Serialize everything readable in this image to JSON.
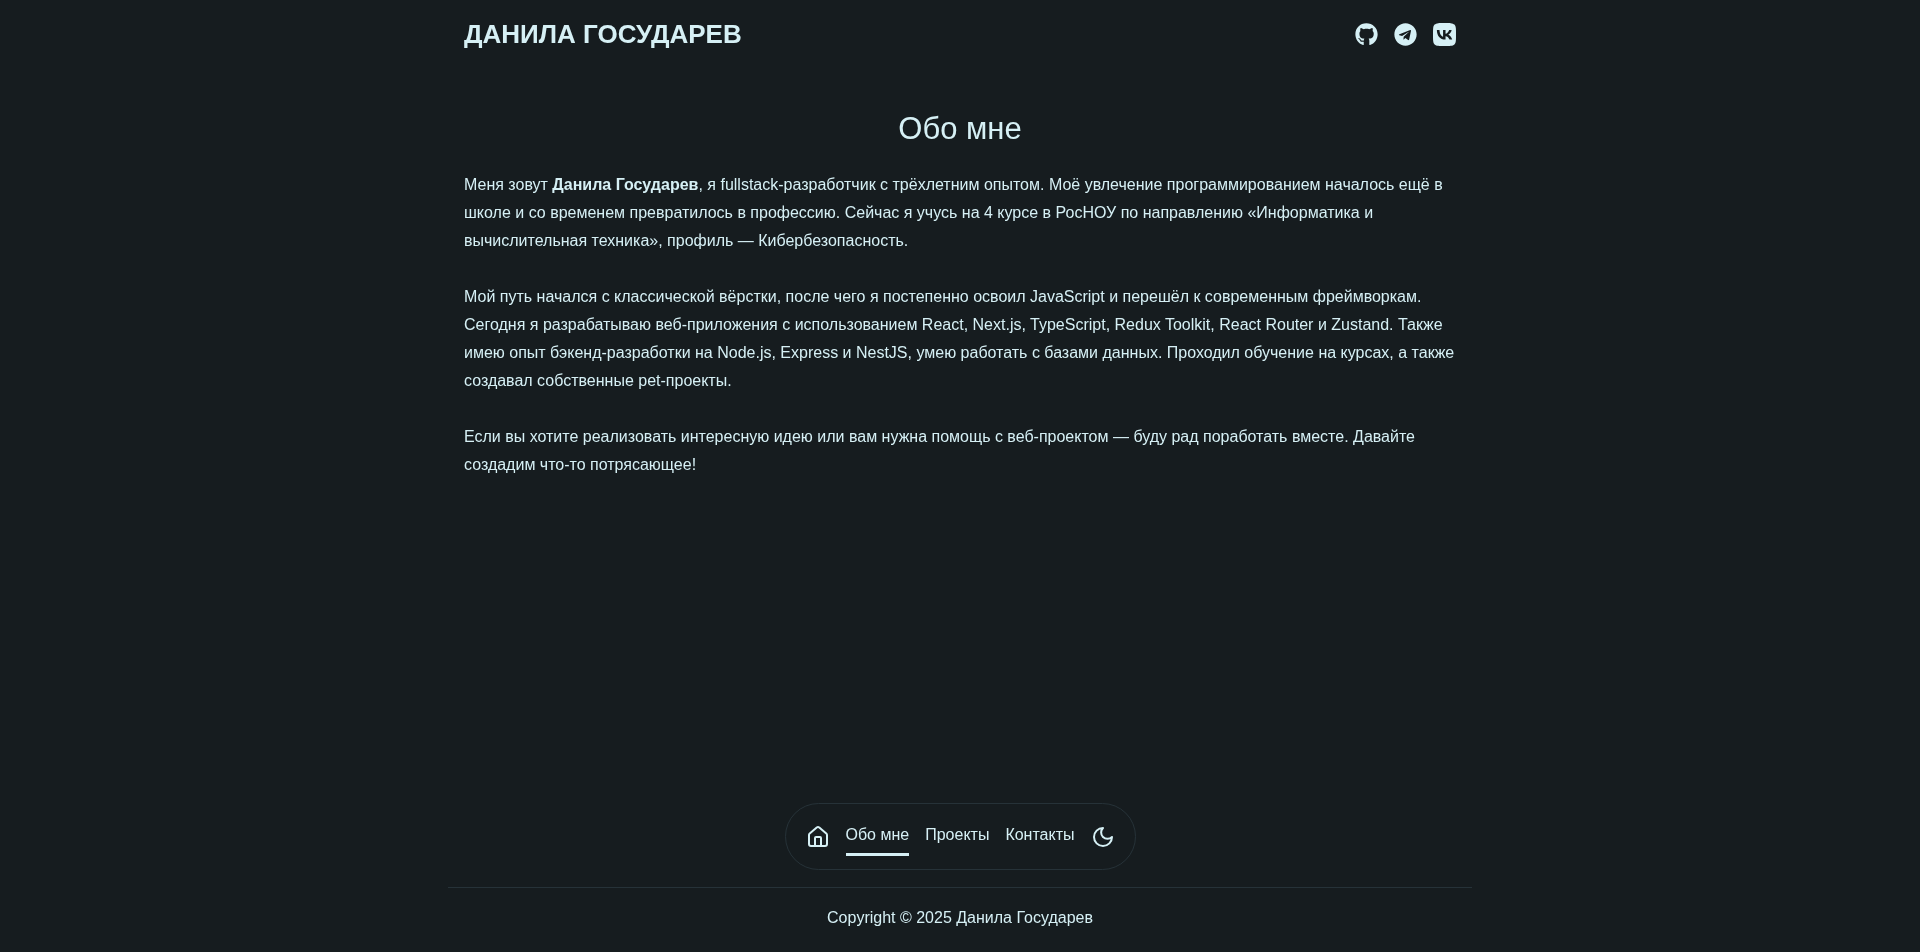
{
  "header": {
    "title": "ДАНИЛА ГОСУДАРЕВ",
    "social_links": [
      {
        "kind": "github"
      },
      {
        "kind": "telegram"
      },
      {
        "kind": "vk"
      }
    ]
  },
  "about": {
    "heading": "Обо мне",
    "paragraphs": [
      "Меня зовут **Данила Государев**, я fullstack-разработчик с трёхлетним опытом. Моё увлечение программированием началось ещё в школе и со временем превратилось в профессию. Сейчас я учусь на 4 курсе в РосНОУ по направлению «Информатика и вычислительная техника», профиль — Кибербезопасность.",
      "Мой путь начался с классической вёрстки, после чего я постепенно освоил JavaScript и перешёл к современным фреймворкам. Сегодня я разрабатываю веб-приложения с использованием React, Next.js, TypeScript, Redux Toolkit, React Router и Zustand. Также имею опыт бэкенд-разработки на Node.js, Express и NestJS, умею работать с базами данных. Проходил обучение на курсах, а также создавал собственные pet-проекты.",
      "Если вы хотите реализовать интересную идею или вам нужна помощь с веб-проектом — буду рад поработать вместе. Давайте создадим что-то потрясающее!"
    ]
  },
  "nav": {
    "items": [
      {
        "label": "Обо мне",
        "selected": true
      },
      {
        "label": "Проекты",
        "selected": false
      },
      {
        "label": "Контакты",
        "selected": false
      }
    ]
  },
  "footer": {
    "copyright": "Copyright © 2025 Данила Государев"
  }
}
